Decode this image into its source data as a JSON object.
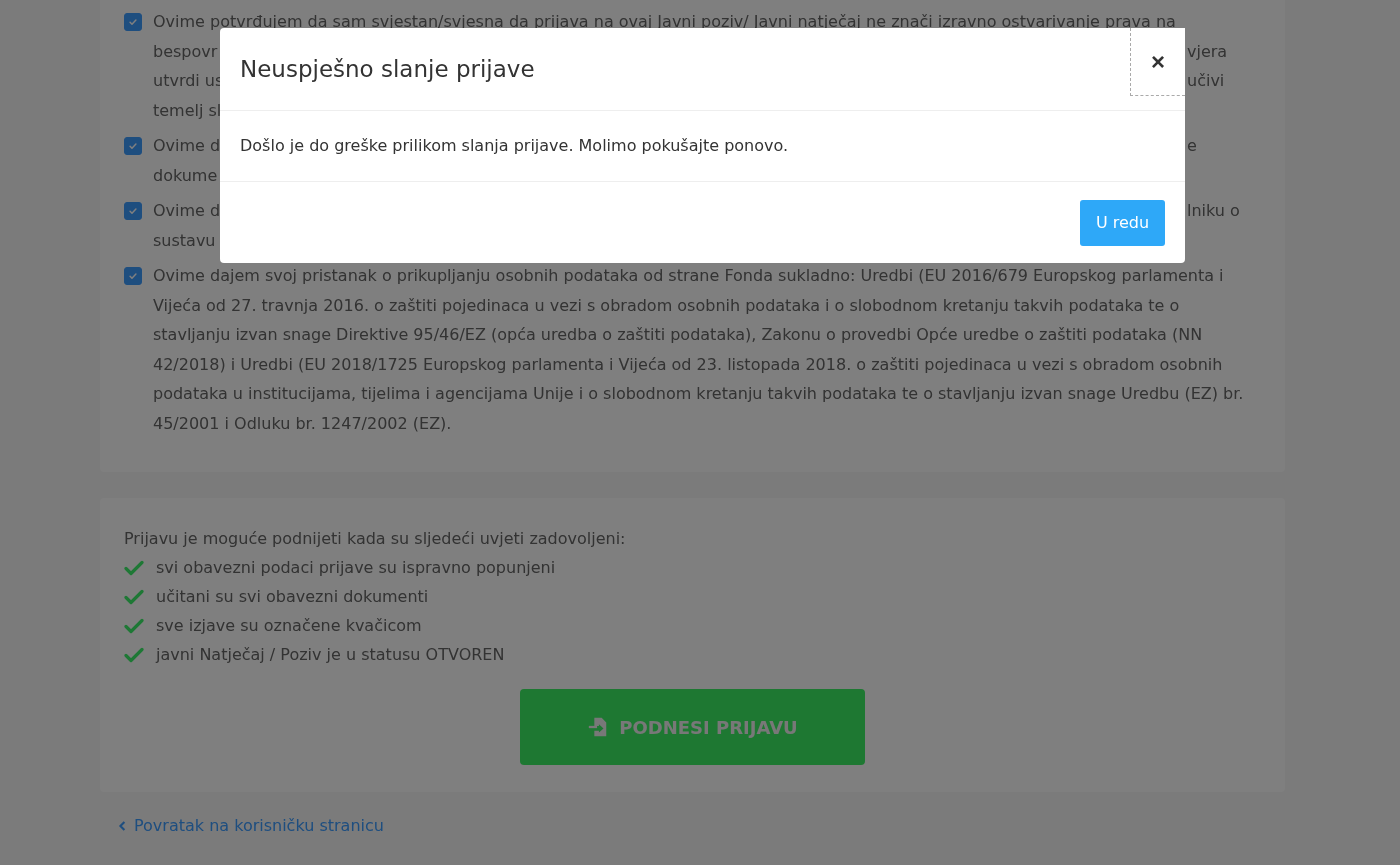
{
  "declarations": [
    {
      "kind": "covered",
      "checked": true,
      "lines": [
        {
          "left": "Ovime potvrđujem da sam svjestan/svjesna da prijava na ovaj Javni poziv/ Javni natječaj ne znači izravno ostvarivanje prava na"
        },
        {
          "left": "bespovr",
          "right": "vjera"
        },
        {
          "left": "utvrdi us",
          "right": "učivi"
        },
        {
          "left": "temelj sl"
        }
      ]
    },
    {
      "kind": "covered",
      "checked": true,
      "lines": [
        {
          "left": "Ovime d",
          "right": "e"
        },
        {
          "left": "dokume"
        }
      ]
    },
    {
      "kind": "covered",
      "checked": true,
      "lines": [
        {
          "left": "Ovime d",
          "right": "lniku o"
        },
        {
          "left": "sustavu"
        }
      ]
    },
    {
      "kind": "full",
      "checked": true,
      "text": "Ovime dajem svoj pristanak o prikupljanju osobnih podataka od strane Fonda sukladno: Uredbi (EU 2016/679 Europskog parlamenta i Vijeća od 27. travnja 2016. o zaštiti pojedinaca u vezi s obradom osobnih podataka i o slobodnom kretanju takvih podataka te o stavljanju izvan snage Direktive 95/46/EZ (opća uredba o zaštiti podataka), Zakonu o provedbi Opće uredbe o zaštiti podataka (NN 42/2018) i Uredbi (EU 2018/1725 Europskog parlamenta i Vijeća od 23. listopada 2018. o zaštiti pojedinaca u vezi s obradom osobnih podataka u institucijama, tijelima i agencijama Unije i o slobodnom kretanju takvih podataka te o stavljanju izvan snage Uredbu (EZ) br. 45/2001 i Odluku br. 1247/2002 (EZ)."
    }
  ],
  "conditions": {
    "intro": "Prijavu je moguće podnijeti kada su sljedeći uvjeti zadovoljeni:",
    "items": [
      {
        "text": "svi obavezni podaci prijave su ispravno popunjeni",
        "met": true
      },
      {
        "text": "učitani su svi obavezni dokumenti",
        "met": true
      },
      {
        "text": "sve izjave su označene kvačicom",
        "met": true
      },
      {
        "text": "javni Natječaj / Poziv je u statusu OTVOREN",
        "met": true
      }
    ]
  },
  "submit_button": {
    "label": "PODNESI PRIJAVU"
  },
  "back_link": {
    "label": "Povratak na korisničku stranicu"
  },
  "modal": {
    "title": "Neuspješno slanje prijave",
    "close_label": "×",
    "message": "Došlo je do greške prilikom slanja prijave. Molimo pokušajte ponovo.",
    "confirm_label": "U redu"
  }
}
